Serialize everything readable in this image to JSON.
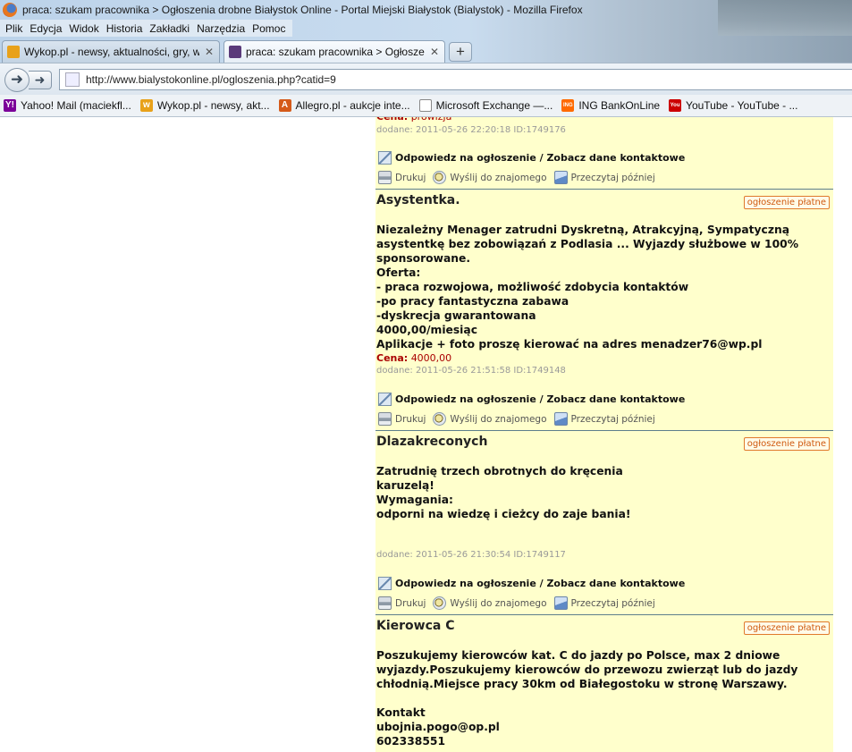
{
  "window": {
    "title": "praca: szukam pracownika > Ogłoszenia drobne Białystok Online - Portal Miejski Białystok (Bialystok) - Mozilla Firefox"
  },
  "menu": [
    "Plik",
    "Edycja",
    "Widok",
    "Historia",
    "Zakładki",
    "Narzędzia",
    "Pomoc"
  ],
  "tabs": [
    {
      "label": "Wykop.pl - newsy, aktualności, gry, w...",
      "active": false
    },
    {
      "label": "praca: szukam pracownika > Ogłosze...",
      "active": true
    }
  ],
  "new_tab_label": "+",
  "address": {
    "url": "http://www.bialystokonline.pl/ogloszenia.php?catid=9"
  },
  "bookmarks": [
    {
      "label": "Yahoo! Mail (maciekfl...",
      "icon": "yahoo-icon",
      "color": "#7b0099",
      "glyph": "Y!"
    },
    {
      "label": "Wykop.pl - newsy, akt...",
      "icon": "wykop-icon",
      "color": "#e8a11a",
      "glyph": "w"
    },
    {
      "label": "Allegro.pl - aukcje inte...",
      "icon": "allegro-icon",
      "color": "#d55a1a",
      "glyph": "A"
    },
    {
      "label": "Microsoft Exchange —...",
      "icon": "page-icon",
      "color": "#ffffff",
      "glyph": ""
    },
    {
      "label": "ING BankOnLine",
      "icon": "ing-lion-icon",
      "color": "#ff6a00",
      "glyph": "ING"
    },
    {
      "label": "YouTube - YouTube - ...",
      "icon": "youtube-icon",
      "color": "#cc0000",
      "glyph": "You"
    }
  ],
  "common": {
    "reply_label": "Odpowiedz na ogłoszenie / Zobacz dane kontaktowe",
    "print_label": "Drukuj",
    "send_label": "Wyślij do znajomego",
    "later_label": "Przeczytaj później",
    "paid_badge": "ogłoszenie płatne",
    "price_label": "Cena:"
  },
  "listings": [
    {
      "partial": true,
      "price_value": "prowizja",
      "meta": "dodane: 2011-05-26 22:20:18   ID:1749176"
    },
    {
      "title": "Asystentka.",
      "body": [
        "Niezależny Menager zatrudni Dyskretną, Atrakcyjną, Sympatyczną",
        "asystentkę bez zobowiązań z Podlasia ... Wyjazdy służbowe w 100%",
        "sponsorowane.",
        "Oferta:",
        "- praca rozwojowa, możliwość zdobycia kontaktów",
        "-po pracy fantastyczna zabawa",
        "-dyskrecja gwarantowana",
        "4000,00/miesiąc",
        "Aplikacje + foto proszę kierować na adres menadzer76@wp.pl"
      ],
      "price_value": "4000,00",
      "meta": "dodane: 2011-05-26 21:51:58   ID:1749148"
    },
    {
      "title": "Dlazakreconych",
      "body": [
        "Zatrudnię trzech obrotnych do kręcenia",
        "karuzelą!",
        "Wymagania:",
        "odporni na wiedzę i cieżcy do zaje bania!"
      ],
      "meta": "dodane: 2011-05-26 21:30:54   ID:1749117"
    },
    {
      "title": "Kierowca C",
      "body": [
        "Poszukujemy kierowców kat. C do jazdy po Polsce, max 2 dniowe",
        "wyjazdy.Poszukujemy kierowców do przewozu zwierząt lub do jazdy",
        "chłodnią.Miejsce pracy 30km od Białegostoku w stronę Warszawy.",
        "",
        "Kontakt",
        "ubojnia.pogo@op.pl",
        "602338551"
      ]
    }
  ],
  "colors": {
    "listing_bg": "#ffffcc",
    "badge_border": "#e07a2c",
    "price_color": "#aa0000",
    "separator": "#5d7e8c"
  }
}
